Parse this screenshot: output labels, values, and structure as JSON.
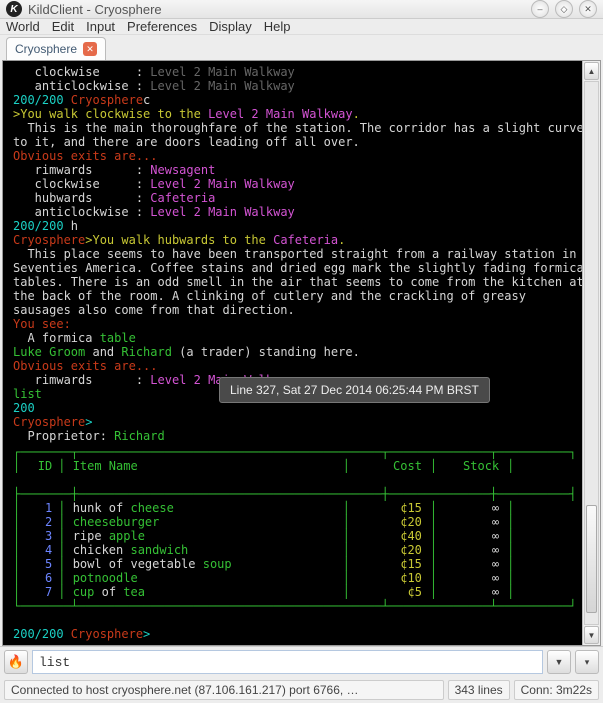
{
  "window": {
    "title": "KildClient - Cryosphere"
  },
  "menu": {
    "world": "World",
    "edit": "Edit",
    "input": "Input",
    "prefs": "Preferences",
    "display": "Display",
    "help": "Help"
  },
  "tab": {
    "name": "Cryosphere"
  },
  "tooltip": "Line 327, Sat 27 Dec 2014 06:25:44 PM BRST",
  "term": {
    "l0a": "   clockwise     : ",
    "l0b": "Level 2 Main Walkway",
    "l1a": "   anticlockwise : ",
    "l1b": "Level 2 Main Walkway",
    "hp": "200/200 ",
    "world": "Cryosphere",
    "cmd_c": "c",
    "walk1": ">You walk clockwise to the ",
    "dest1": "Level 2 Main Walkway",
    "dot": ".",
    "desc1": "  This is the main thoroughfare of the station. The corridor has a slight curve\nto it, and there are doors leading off all over.",
    "exits": "Obvious exits are...",
    "ex_rim": "   rimwards      : ",
    "ex_rim_v": "Newsagent",
    "ex_cw": "   clockwise     : ",
    "ex_cw_v": "Level 2 Main Walkway",
    "ex_hub": "   hubwards      : ",
    "ex_hub_v": "Cafeteria",
    "ex_acw": "   anticlockwise : ",
    "ex_acw_v": "Level 2 Main Walkway",
    "cmd_h": "h",
    "walk2": ">You walk hubwards to the ",
    "dest2": "Cafeteria",
    "desc2": "  This place seems to have been transported straight from a railway station in\nSeventies America. Coffee stains and dried egg mark the slightly fading formica\ntables. There is an odd smell in the air that seems to come from the kitchen at\nthe back of the room. A clinking of cutlery and the crackling of greasy\nsausages also come from that direction.",
    "yousee": "You see:",
    "see1a": "  A formica ",
    "see1b": "table",
    "p1": "Luke Groom",
    "and": " and ",
    "p2": "Richard",
    "p_tail": " (a trader) standing here.",
    "ex2_rim": "   rimwards      : ",
    "ex2_rim_v": "Level 2 Main Walkway",
    "cmd_list": "list",
    "hp200": "200",
    "prompt_gt": ">",
    "prop_label": "  Proprietor: ",
    "prop_name": "Richard"
  },
  "table": {
    "border_top": "┌───────┬──────────────────────────────────────────┬──────────────┬──────────┐",
    "h_id": "ID",
    "h_name": "Item Name",
    "h_cost": "Cost",
    "h_stock": "Stock",
    "border_mid": "├───────┼──────────────────────────────────────────┼──────────────┼──────────┤",
    "rows": [
      {
        "id": "1",
        "n1": "hunk of ",
        "n2": "cheese",
        "cost": "¢15",
        "stock": "∞"
      },
      {
        "id": "2",
        "n1": "",
        "n2": "cheeseburger",
        "cost": "¢20",
        "stock": "∞"
      },
      {
        "id": "3",
        "n1": "ripe ",
        "n2": "apple",
        "cost": "¢40",
        "stock": "∞"
      },
      {
        "id": "4",
        "n1": "chicken ",
        "n2": "sandwich",
        "cost": "¢20",
        "stock": "∞"
      },
      {
        "id": "5",
        "n1": "bowl of vegetable ",
        "n2": "soup",
        "cost": "¢15",
        "stock": "∞"
      },
      {
        "id": "6",
        "n1": "",
        "n2": "potnoodle",
        "cost": "¢10",
        "stock": "∞"
      },
      {
        "id": "7",
        "n1": "cup",
        "n1b": " of ",
        "n2": "tea",
        "cost": "¢5",
        "stock": "∞"
      }
    ],
    "border_bot": "└───────┴──────────────────────────────────────────┴──────────────┴──────────┘"
  },
  "input": {
    "value": "list"
  },
  "status": {
    "main": "Connected to host cryosphere.net (87.106.161.217) port 6766, …",
    "lines": "343 lines",
    "conn": "Conn: 3m22s"
  }
}
